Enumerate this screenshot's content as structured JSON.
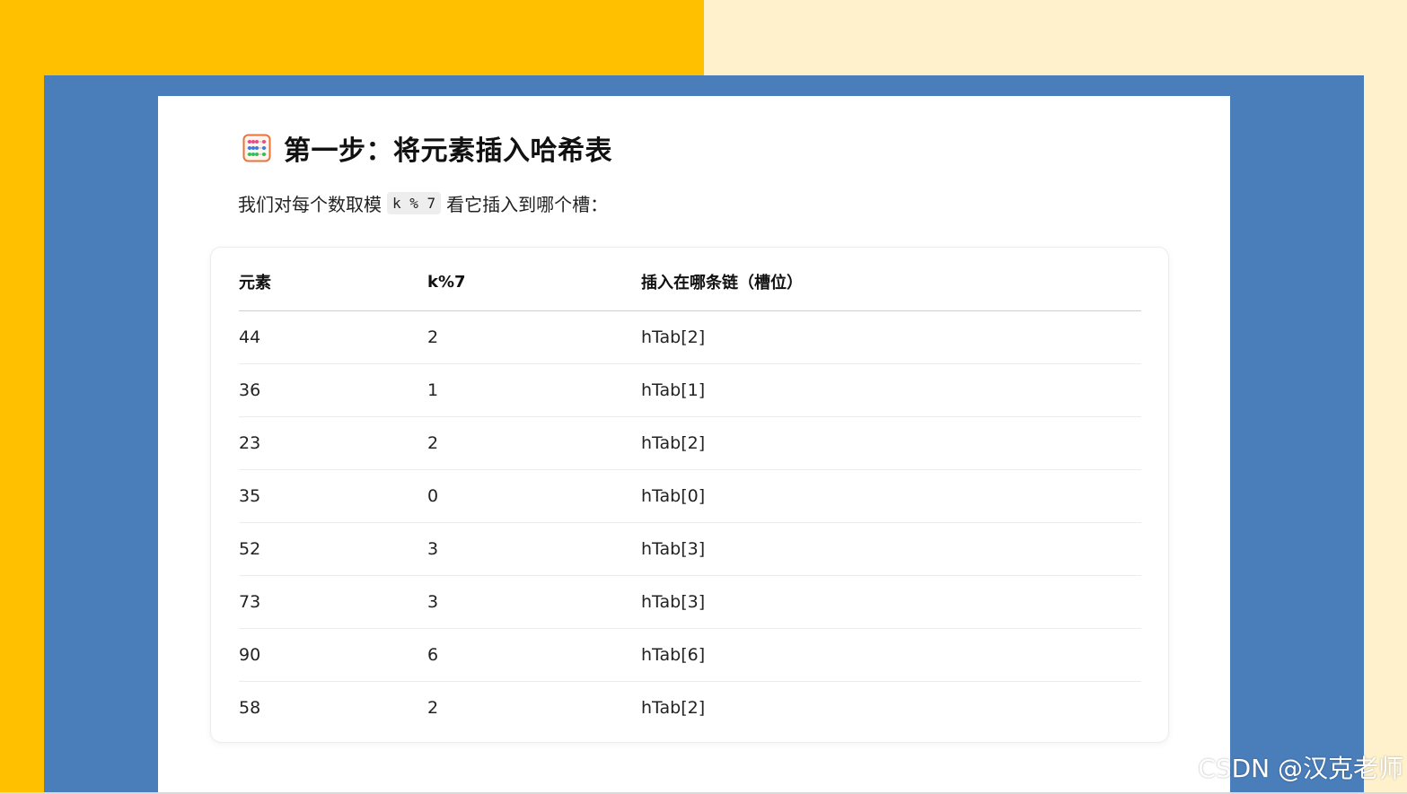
{
  "heading": {
    "icon": "abacus-icon",
    "title": "第一步：将元素插入哈希表"
  },
  "intro": {
    "before": "我们对每个数取模",
    "code": "k % 7",
    "after": "看它插入到哪个槽："
  },
  "table": {
    "headers": [
      "元素",
      "k%7",
      "插入在哪条链（槽位）"
    ],
    "rows": [
      [
        "44",
        "2",
        "hTab[2]"
      ],
      [
        "36",
        "1",
        "hTab[1]"
      ],
      [
        "23",
        "2",
        "hTab[2]"
      ],
      [
        "35",
        "0",
        "hTab[0]"
      ],
      [
        "52",
        "3",
        "hTab[3]"
      ],
      [
        "73",
        "3",
        "hTab[3]"
      ],
      [
        "90",
        "6",
        "hTab[6]"
      ],
      [
        "58",
        "2",
        "hTab[2]"
      ]
    ]
  },
  "watermark": "CSDN @汉克老师",
  "colors": {
    "left_background": "#ffc000",
    "right_background": "#fff1cc",
    "frame": "#4a7ebb"
  }
}
